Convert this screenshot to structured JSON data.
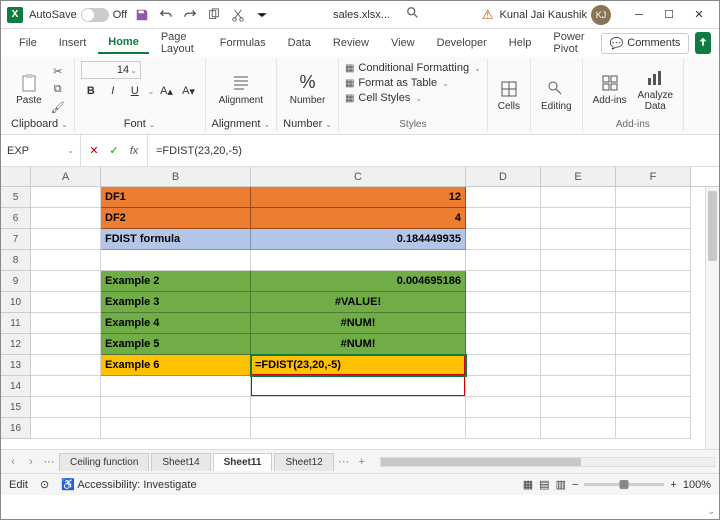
{
  "titlebar": {
    "autosave": "AutoSave",
    "autosave_state": "Off",
    "filename": "sales.xlsx...",
    "user_name": "Kunal Jai Kaushik",
    "user_initials": "KJ"
  },
  "tabs": {
    "file": "File",
    "insert": "Insert",
    "home": "Home",
    "page_layout": "Page Layout",
    "formulas": "Formulas",
    "data": "Data",
    "review": "Review",
    "view": "View",
    "developer": "Developer",
    "help": "Help",
    "power_pivot": "Power Pivot",
    "comments": "Comments"
  },
  "ribbon": {
    "clipboard": {
      "label": "Clipboard",
      "paste": "Paste"
    },
    "font": {
      "label": "Font",
      "size": "14",
      "bold": "B",
      "italic": "I",
      "underline": "U"
    },
    "alignment": {
      "label": "Alignment",
      "btn": "Alignment"
    },
    "number": {
      "label": "Number",
      "btn": "Number"
    },
    "styles": {
      "label": "Styles",
      "cond": "Conditional Formatting",
      "table": "Format as Table",
      "cell": "Cell Styles"
    },
    "cells": {
      "label": "Cells",
      "btn": "Cells"
    },
    "editing": {
      "label": "Editing",
      "btn": "Editing"
    },
    "addins": {
      "label": "Add-ins",
      "addins_btn": "Add-ins",
      "analyze": "Analyze\nData"
    }
  },
  "formula_bar": {
    "name_box": "EXP",
    "formula": "=FDIST(23,20,-5)"
  },
  "columns": [
    "A",
    "B",
    "C",
    "D",
    "E",
    "F"
  ],
  "rows": [
    {
      "n": "5",
      "B": "DF1",
      "C": "12",
      "cls": "orange",
      "calign": "right"
    },
    {
      "n": "6",
      "B": "DF2",
      "C": "4",
      "cls": "orange",
      "calign": "right"
    },
    {
      "n": "7",
      "B": "FDIST formula",
      "C": "0.184449935",
      "cls": "blue",
      "calign": "right"
    },
    {
      "n": "8"
    },
    {
      "n": "9",
      "B": "Example 2",
      "C": "0.004695186",
      "cls": "green",
      "calign": "right"
    },
    {
      "n": "10",
      "B": "Example 3",
      "C": "#VALUE!",
      "cls": "green",
      "calign": "center"
    },
    {
      "n": "11",
      "B": "Example 4",
      "C": "#NUM!",
      "cls": "green",
      "calign": "center"
    },
    {
      "n": "12",
      "B": "Example 5",
      "C": "#NUM!",
      "cls": "green",
      "calign": "center"
    },
    {
      "n": "13",
      "B": "Example 6",
      "C": "=FDIST(23,20,-5)",
      "cls": "yellow",
      "active": true
    },
    {
      "n": "14"
    },
    {
      "n": "15"
    },
    {
      "n": "16"
    }
  ],
  "sheets": {
    "s1": "Ceiling function",
    "s2": "Sheet14",
    "s3": "Sheet11",
    "s4": "Sheet12"
  },
  "status": {
    "mode": "Edit",
    "accessibility": "Accessibility: Investigate",
    "zoom": "100%"
  }
}
